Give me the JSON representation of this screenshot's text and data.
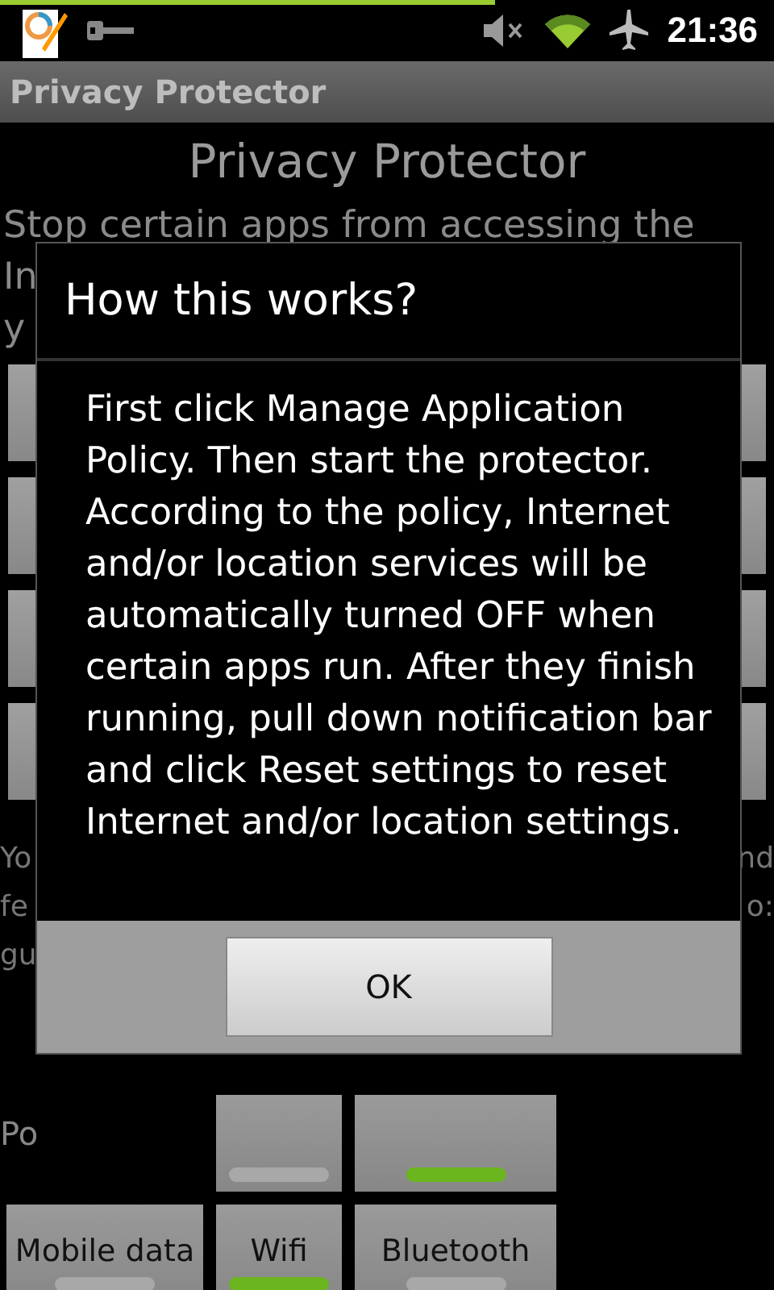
{
  "status_bar": {
    "progress": {
      "level": 0.64
    },
    "time": "21:36"
  },
  "action_bar": {
    "title": "Privacy Protector"
  },
  "heading": "Privacy Protector",
  "description_lines": [
    "Stop certain apps from accessing the",
    "In",
    "y"
  ],
  "feedback": [
    {
      "start": "Yo",
      "end": "nd"
    },
    {
      "start": "fe",
      "end": "o:"
    },
    {
      "start": "gu"
    }
  ],
  "section_label": "Po",
  "toggle_rows": [
    {
      "tiles": [
        {
          "on": false
        },
        {
          "on": true
        }
      ]
    },
    {
      "tiles": [
        {
          "label": "Mobile data",
          "on": false
        },
        {
          "label": "Wifi",
          "on": true
        },
        {
          "label": "Bluetooth",
          "on": false
        }
      ]
    }
  ],
  "dialog": {
    "title": "How this works?",
    "message": "First click Manage Application Policy. Then start the protector. According to the policy, Internet and/or location services will be automatically turned OFF when certain apps run. After they finish running, pull down notification bar and click Reset settings to reset Internet and/or location settings.",
    "buttons": [
      "OK"
    ]
  }
}
